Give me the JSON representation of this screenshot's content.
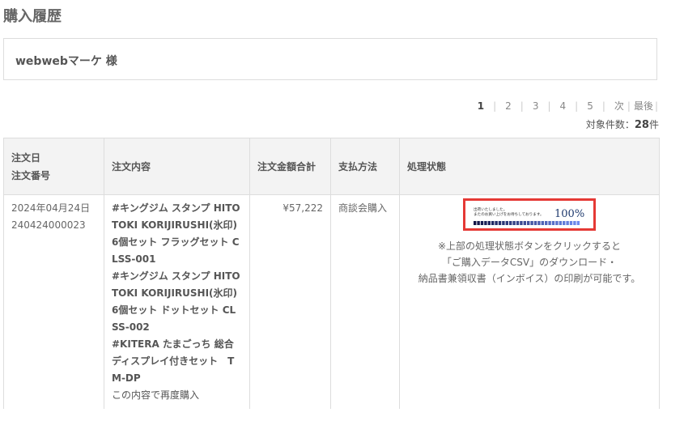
{
  "page": {
    "title": "購入履歴"
  },
  "customer": {
    "name": "webwebマーケ 様"
  },
  "pagination": {
    "pages": [
      "1",
      "2",
      "3",
      "4",
      "5"
    ],
    "next": "次",
    "last": "最後",
    "count_label": "対象件数：",
    "count_value": "28",
    "count_unit": "件"
  },
  "table": {
    "headers": {
      "date_line1": "注文日",
      "date_line2": "注文番号",
      "content": "注文内容",
      "amount": "注文金額合計",
      "payment": "支払方法",
      "status": "処理状態"
    },
    "rows": [
      {
        "date": "2024年04月24日",
        "order_no": "240424000023",
        "items": [
          "#キングジム スタンプ HITOTOKI KORIJIRUSHI(氷印) 6個セット フラッグセット CLSS-001",
          "#キングジム スタンプ HITOTOKI KORIJIRUSHI(氷印) 6個セット ドットセット CLSS-002",
          "#KITERA たまごっち 総合ディスプレイ付きセット　TM-DP"
        ],
        "reorder": "この内容で再度購入",
        "amount": "¥57,222",
        "payment": "商談会購入",
        "status_image": {
          "line1": "出荷いたしました。",
          "line2": "またのお買い上げをお待ちしております。",
          "percent": "100%",
          "bar_color": "#1f3a6e"
        },
        "status_note": [
          "※上部の処理状態ボタンをクリックすると",
          "「ご購入データCSV」のダウンロード・",
          "納品書兼領収書（インボイス）の印刷が可能です。"
        ]
      }
    ]
  },
  "colors": {
    "highlight_border": "#e53935",
    "header_bg": "#f3f3f3",
    "border": "#dddddd"
  }
}
